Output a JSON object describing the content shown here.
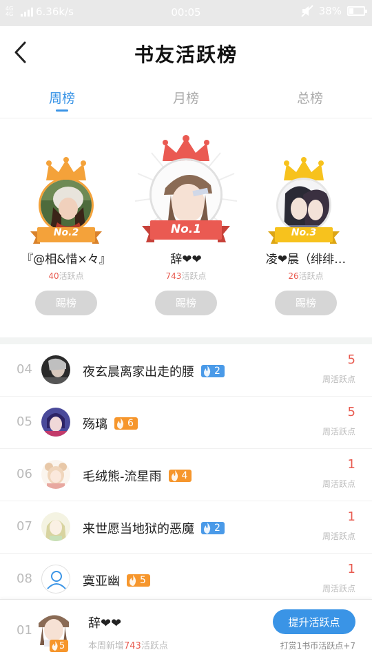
{
  "status_bar": {
    "signal_tiny": "4G 4G",
    "speed": "6.36k/s",
    "time": "00:05",
    "battery": "38%"
  },
  "header": {
    "title": "书友活跃榜"
  },
  "tabs": [
    {
      "label": "周榜",
      "active": true
    },
    {
      "label": "月榜",
      "active": false
    },
    {
      "label": "总榜",
      "active": false
    }
  ],
  "podium": {
    "first": {
      "rank_label": "No.1",
      "name": "辞❤❤",
      "points": "743",
      "points_unit": "活跃点",
      "button": "踢榜"
    },
    "second": {
      "rank_label": "No.2",
      "name": "『@相&惜×々』",
      "points": "40",
      "points_unit": "活跃点",
      "button": "踢榜"
    },
    "third": {
      "rank_label": "No.3",
      "name": "凌❤晨（绯绯…",
      "points": "26",
      "points_unit": "活跃点",
      "button": "踢榜"
    }
  },
  "list": [
    {
      "rank": "04",
      "name": "夜玄晨离家出走的腰",
      "level": "2",
      "level_color": "blue",
      "score": "5",
      "unit": "周活跃点"
    },
    {
      "rank": "05",
      "name": "殇璃",
      "level": "6",
      "level_color": "orange",
      "score": "5",
      "unit": "周活跃点"
    },
    {
      "rank": "06",
      "name": "毛绒熊-流星雨",
      "level": "4",
      "level_color": "orange",
      "score": "1",
      "unit": "周活跃点"
    },
    {
      "rank": "07",
      "name": "来世愿当地狱的恶魔",
      "level": "2",
      "level_color": "blue",
      "score": "1",
      "unit": "周活跃点"
    },
    {
      "rank": "08",
      "name": "寞亚幽",
      "level": "5",
      "level_color": "orange",
      "score": "1",
      "unit": "周活跃点"
    }
  ],
  "me": {
    "rank": "01",
    "name": "辞❤❤",
    "level": "5",
    "weekly_prefix": "本周新增",
    "weekly_points": "743",
    "weekly_suffix": "活跃点",
    "boost_button": "提升活跃点",
    "tip": "打赏1书币活跃点+7"
  },
  "colors": {
    "accent": "#3a94e6",
    "points_red": "#e85a4f",
    "level_blue": "#4a9ae8",
    "level_orange": "#f6962c",
    "ribbon_orange": "#f4a23a",
    "ribbon_red": "#ea5a52",
    "ribbon_yellow": "#f7c21d"
  },
  "icons": [
    "back-chevron-icon",
    "mute-icon",
    "signal-bars-icon",
    "battery-icon",
    "crown-icon",
    "flame-icon",
    "default-avatar-icon"
  ]
}
